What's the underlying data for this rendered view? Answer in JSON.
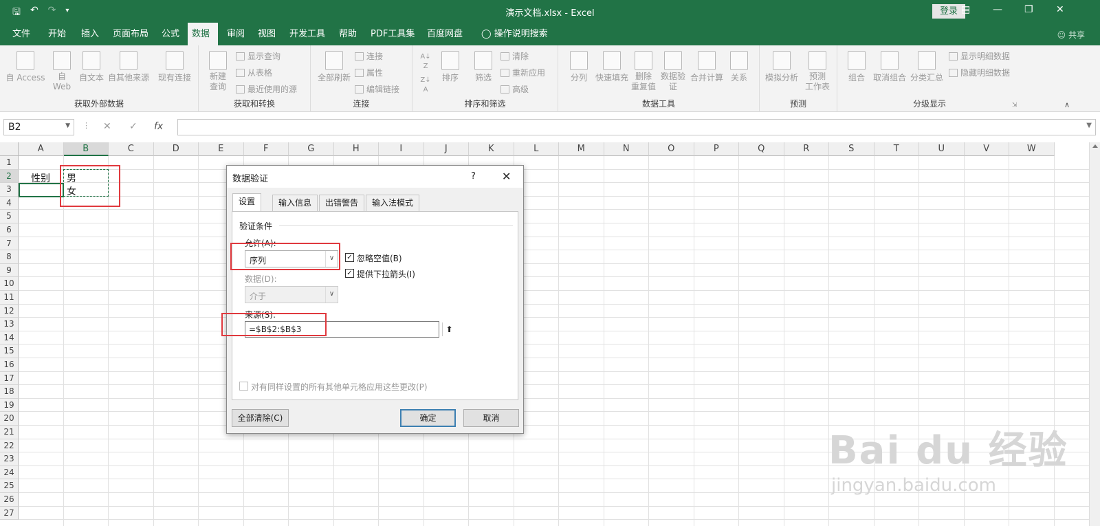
{
  "window": {
    "title": "演示文档.xlsx - Excel",
    "login_label": "登录",
    "share_label": "共享",
    "qat_icons": [
      "save-icon",
      "undo-icon",
      "redo-icon",
      "customize-icon"
    ]
  },
  "tabs": [
    "文件",
    "开始",
    "插入",
    "页面布局",
    "公式",
    "数据",
    "审阅",
    "视图",
    "开发工具",
    "帮助",
    "PDF工具集",
    "百度网盘",
    "操作说明搜索"
  ],
  "active_tab": "数据",
  "ribbon": {
    "groups": {
      "get_external": {
        "label": "获取外部数据",
        "buttons": [
          "自 Access",
          "自\nWeb",
          "自文本",
          "自其他来源",
          "现有连接"
        ]
      },
      "get_transform": {
        "label": "获取和转换",
        "new_query": "新建\n查询",
        "small": [
          "显示查询",
          "从表格",
          "最近使用的源"
        ]
      },
      "connections": {
        "label": "连接",
        "refresh_all": "全部刷新",
        "small": [
          "连接",
          "属性",
          "编辑链接"
        ]
      },
      "sort_filter": {
        "label": "排序和筛选",
        "sort": "排序",
        "filter": "筛选",
        "small": [
          "清除",
          "重新应用",
          "高级"
        ]
      },
      "data_tools": {
        "label": "数据工具",
        "buttons": [
          "分列",
          "快速填充",
          "删除\n重复值",
          "数据验\n证",
          "合并计算",
          "关系"
        ]
      },
      "forecast": {
        "label": "预测",
        "buttons": [
          "模拟分析",
          "预测\n工作表"
        ]
      },
      "outline": {
        "label": "分级显示",
        "buttons": [
          "组合",
          "取消组合",
          "分类汇总"
        ],
        "small": [
          "显示明细数据",
          "隐藏明细数据"
        ]
      }
    }
  },
  "formula_bar": {
    "name_box": "B2",
    "fx": "fx",
    "value": ""
  },
  "sheet": {
    "columns": [
      "A",
      "B",
      "C",
      "D",
      "E",
      "F",
      "G",
      "H",
      "I",
      "J",
      "K",
      "L",
      "M",
      "N",
      "O",
      "P",
      "Q",
      "R",
      "S",
      "T",
      "U",
      "V",
      "W"
    ],
    "rows": [
      "1",
      "2",
      "3",
      "4",
      "5",
      "6",
      "7",
      "8",
      "9",
      "10",
      "11",
      "12",
      "13",
      "14",
      "15",
      "16",
      "17",
      "18",
      "19",
      "20",
      "21",
      "22",
      "23",
      "24",
      "25",
      "26",
      "27"
    ],
    "cells": {
      "A2": "性别",
      "B2": "男",
      "B3": "女"
    }
  },
  "dialog": {
    "title": "数据验证",
    "help": "?",
    "close": "✕",
    "tabs": [
      "设置",
      "输入信息",
      "出错警告",
      "输入法模式"
    ],
    "section": "验证条件",
    "allow_label": "允许(A):",
    "allow_value": "序列",
    "ignore_blank": "忽略空值(B)",
    "dropdown": "提供下拉箭头(I)",
    "data_label": "数据(D):",
    "data_value": "介于",
    "source_label": "来源(S):",
    "source_value": "=$B$2:$B$3",
    "apply_all": "对有同样设置的所有其他单元格应用这些更改(P)",
    "clear_all": "全部清除(C)",
    "ok": "确定",
    "cancel": "取消"
  },
  "watermark": {
    "brand": "Bai  du 经验",
    "url": "jingyan.baidu.com"
  },
  "colors": {
    "excel_green": "#217346",
    "highlight_red": "#e0393e"
  }
}
